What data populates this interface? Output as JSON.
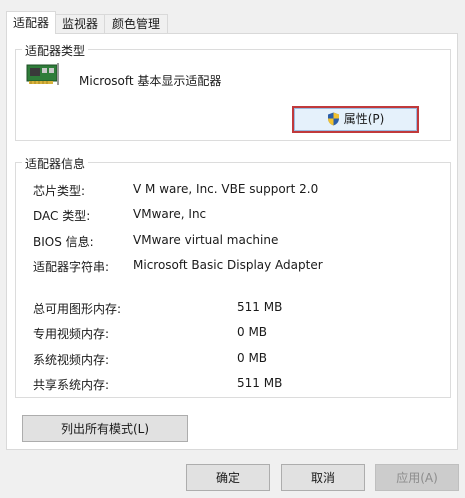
{
  "tabs": [
    {
      "label": "适配器",
      "active": true
    },
    {
      "label": "监视器",
      "active": false
    },
    {
      "label": "颜色管理",
      "active": false
    }
  ],
  "adapter_type": {
    "legend": "适配器类型",
    "icon": "graphics-card-icon",
    "name": "Microsoft 基本显示适配器",
    "properties_button": "属性(P)"
  },
  "adapter_info": {
    "legend": "适配器信息",
    "rows": [
      {
        "label": "芯片类型:",
        "value": "V M ware, Inc. VBE support 2.0"
      },
      {
        "label": "DAC 类型:",
        "value": "VMware, Inc"
      },
      {
        "label": "BIOS 信息:",
        "value": "VMware virtual machine"
      },
      {
        "label": "适配器字符串:",
        "value": "Microsoft Basic Display Adapter"
      }
    ],
    "memory": [
      {
        "label": "总可用图形内存:",
        "value": "511 MB"
      },
      {
        "label": "专用视频内存:",
        "value": "0 MB"
      },
      {
        "label": "系统视频内存:",
        "value": "0 MB"
      },
      {
        "label": "共享系统内存:",
        "value": "511 MB"
      }
    ]
  },
  "list_modes_button": "列出所有模式(L)",
  "dialog_buttons": {
    "ok": "确定",
    "cancel": "取消",
    "apply": "应用(A)"
  },
  "colors": {
    "focus_border": "#c0393b",
    "button_face": "#e1e1e1"
  }
}
